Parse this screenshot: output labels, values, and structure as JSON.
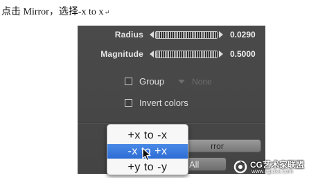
{
  "caption": {
    "text": "点击 Mirror，选择-x to x",
    "mark": "↵"
  },
  "params": [
    {
      "label": "Radius",
      "value": "0.0290"
    },
    {
      "label": "Magnitude",
      "value": "0.5000"
    }
  ],
  "options": {
    "group_label": "Group",
    "group_dropdown_value": "None",
    "invert_label": "Invert colors"
  },
  "buttons": {
    "mirror_label_partial": "rror",
    "all_label_partial": "All"
  },
  "popup": {
    "items": [
      "+x to -x",
      "-x to +x",
      "+y to -y"
    ],
    "selected_index": 1
  },
  "watermark": {
    "title": "CG艺术家联盟",
    "url": "www.cgtuse.com"
  },
  "colors": {
    "panel_bg": "#464646",
    "menu_highlight": "#3a7bdc",
    "text_light": "#e8e8e8"
  }
}
